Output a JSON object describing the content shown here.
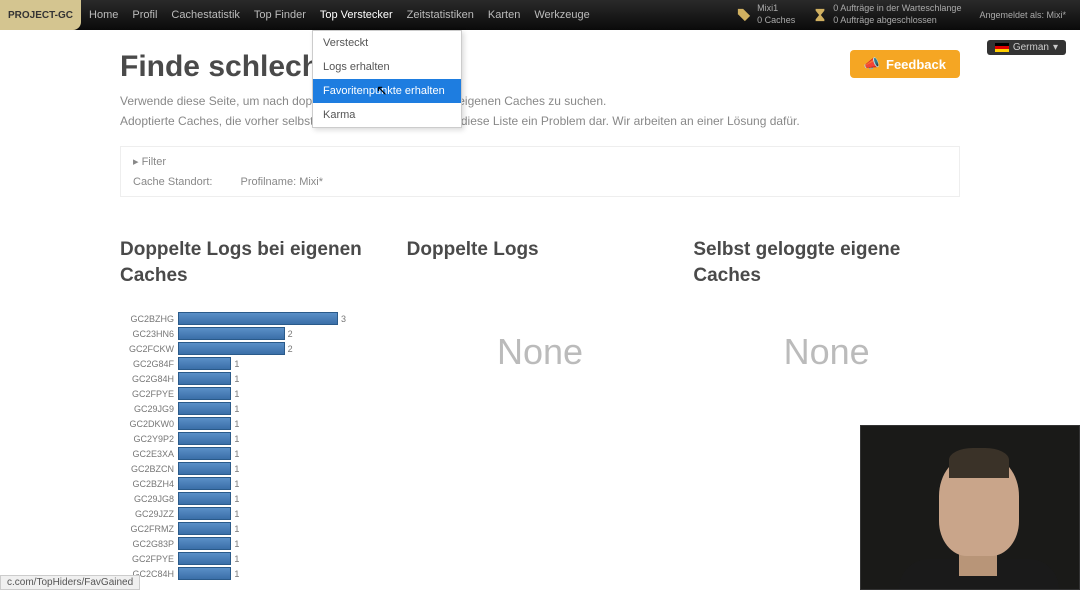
{
  "logo": "PROJECT-GC",
  "nav": [
    "Home",
    "Profil",
    "Cachestatistik",
    "Top Finder",
    "Top Verstecker",
    "Zeitstatistiken",
    "Karten",
    "Werkzeuge"
  ],
  "top_right": {
    "user": "Mixi1",
    "caches": "0 Caches",
    "queue1": "0 Aufträge in der Warteschlange",
    "queue2": "0 Aufträge abgeschlossen",
    "logged_as": "Angemeldet als: Mixi*"
  },
  "lang": "German",
  "dropdown": {
    "items": [
      "Versteckt",
      "Logs erhalten",
      "Favoritenpunkte erhalten",
      "Karma"
    ],
    "highlighted": 2
  },
  "page": {
    "title": "Finde schlechte",
    "desc1": "Verwende diese Seite, um nach dopp                                                              versehentlichen Logs bei eigenen Caches zu suchen.",
    "desc2": "Adoptierte Caches, die vorher selbst geloggt wurden, stellen für diese Liste ein Problem dar. Wir arbeiten an einer Lösung dafür."
  },
  "feedback": "Feedback",
  "filter": {
    "header": "▸ Filter",
    "location_label": "Cache Standort:",
    "profile_label": "Profilname: Mixi*"
  },
  "columns": {
    "c1": "Doppelte Logs bei eigenen Caches",
    "c2": "Doppelte Logs",
    "c3": "Selbst geloggte eigene Caches",
    "none": "None"
  },
  "chart_data": {
    "type": "bar",
    "title": "Doppelte Logs bei eigenen Caches",
    "xlabel": "",
    "ylabel": "",
    "ylim": [
      0,
      3
    ],
    "categories": [
      "GC2BZHG",
      "GC23HN6",
      "GC2FCKW",
      "GC2G84F",
      "GC2G84H",
      "GC2FPYE",
      "GC29JG9",
      "GC2DKW0",
      "GC2Y9P2",
      "GC2E3XA",
      "GC2BZCN",
      "GC2BZH4",
      "GC29JG8",
      "GC29JZZ",
      "GC2FRMZ",
      "GC2G83P",
      "GC2FPYE",
      "GC2C84H"
    ],
    "values": [
      3,
      2,
      2,
      1,
      1,
      1,
      1,
      1,
      1,
      1,
      1,
      1,
      1,
      1,
      1,
      1,
      1,
      1
    ]
  },
  "status_url": "c.com/TopHiders/FavGained"
}
